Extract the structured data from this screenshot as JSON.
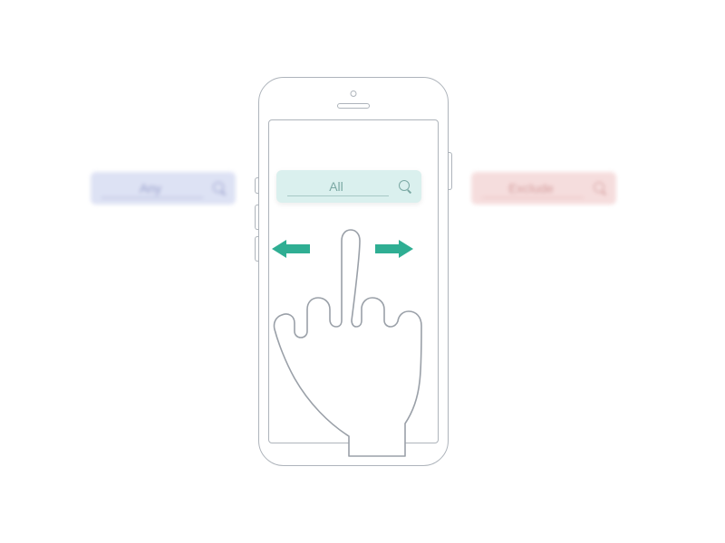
{
  "filters": {
    "previous": {
      "label": "Any"
    },
    "current": {
      "label": "All"
    },
    "next": {
      "label": "Exclude"
    }
  },
  "gesture": {
    "type": "swipe-horizontal"
  },
  "colors": {
    "any_bg": "#dadff3",
    "all_bg": "#daf0ee",
    "exclude_bg": "#f5dada",
    "arrow": "#2fae93",
    "outline": "#aeb4bb"
  }
}
